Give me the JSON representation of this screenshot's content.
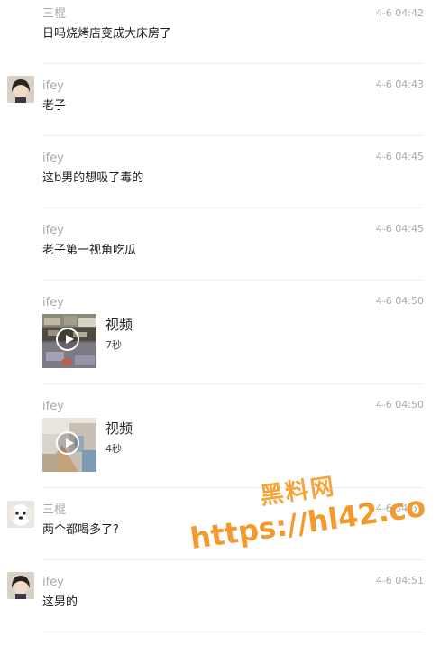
{
  "messages": [
    {
      "sender": "三棍",
      "time": "4-6 04:42",
      "text": "日吗烧烤店变成大床房了"
    },
    {
      "sender": "ifey",
      "time": "4-6 04:43",
      "text": "老子"
    },
    {
      "sender": "ifey",
      "time": "4-6 04:45",
      "text": "这b男的想吸了毒的"
    },
    {
      "sender": "ifey",
      "time": "4-6 04:45",
      "text": "老子第一视角吃瓜"
    },
    {
      "sender": "ifey",
      "time": "4-6 04:50",
      "video_label": "视频",
      "duration": "7秒"
    },
    {
      "sender": "ifey",
      "time": "4-6 04:50",
      "video_label": "视频",
      "duration": "4秒"
    },
    {
      "sender": "三棍",
      "time": "4-6 04:51",
      "text": "两个都喝多了?"
    },
    {
      "sender": "ifey",
      "time": "4-6 04:51",
      "text": "这男的"
    }
  ],
  "watermark": {
    "title": "黑料网",
    "url": "https://hl42.co"
  },
  "colors": {
    "meta_gray": "#a9a9a9",
    "divider": "#ededed",
    "watermark_orange": "#f29a2e"
  }
}
